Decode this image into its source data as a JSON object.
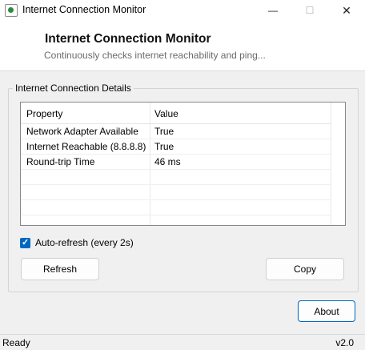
{
  "window": {
    "title": "Internet Connection Monitor",
    "minimize_glyph": "—",
    "maximize_glyph": "☐",
    "close_glyph": "✕"
  },
  "header": {
    "title": "Internet Connection Monitor",
    "subtitle": "Continuously checks internet reachability and ping..."
  },
  "details": {
    "group_label": "Internet Connection Details",
    "columns": [
      "Property",
      "Value"
    ],
    "rows": [
      {
        "property": "Network Adapter Available",
        "value": "True"
      },
      {
        "property": "Internet Reachable (8.8.8.8)",
        "value": "True"
      },
      {
        "property": "Round-trip Time",
        "value": "46 ms"
      }
    ],
    "empty_rows": 3
  },
  "auto_refresh": {
    "label": "Auto-refresh (every 2s)",
    "checked": true,
    "check_glyph": "✓"
  },
  "buttons": {
    "refresh": "Refresh",
    "copy": "Copy",
    "about": "About"
  },
  "status": {
    "text": "Ready",
    "version": "v2.0"
  },
  "colors": {
    "accent": "#0067c0",
    "icon_green": "#2e8b3d"
  }
}
